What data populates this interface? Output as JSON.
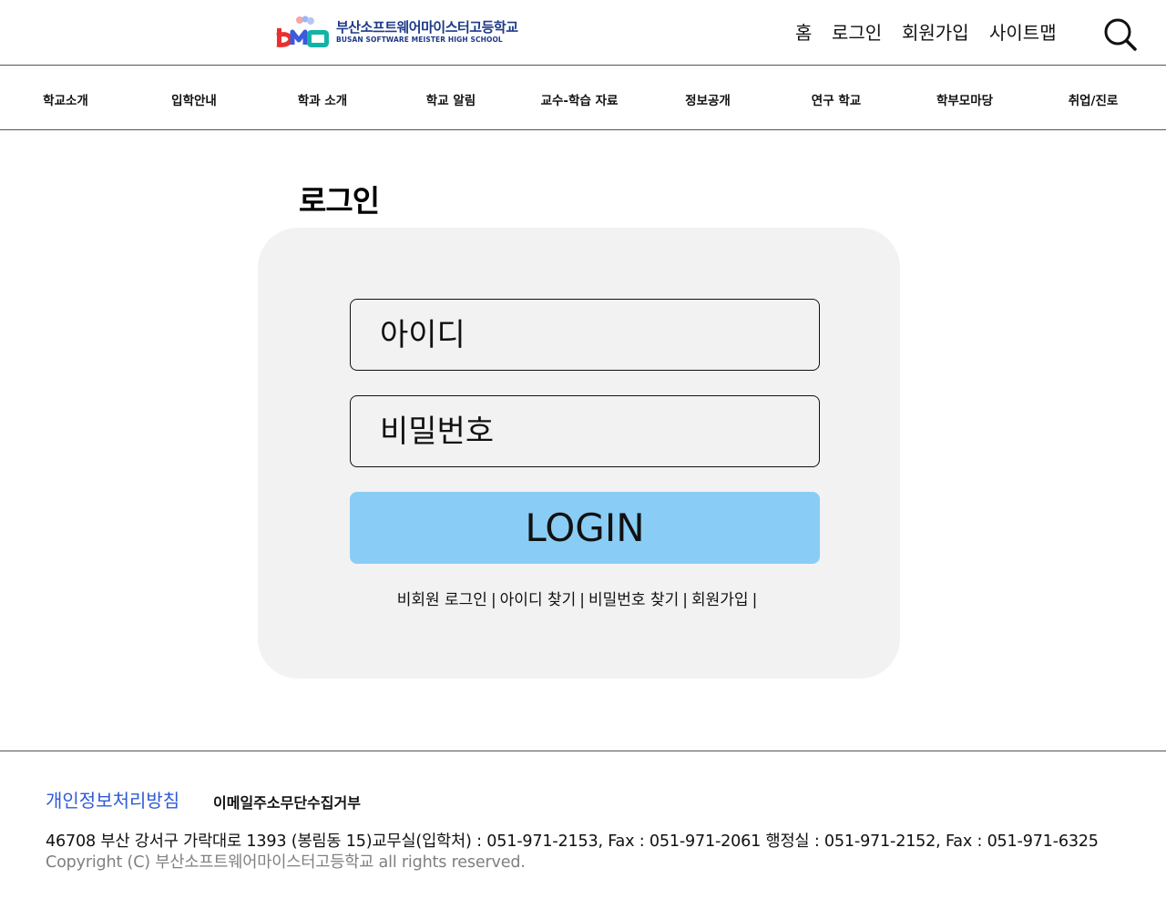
{
  "header": {
    "logo": {
      "name_ko": "부산소프트웨어마이스터고등학교",
      "name_en": "BUSAN SOFTWARE MEISTER HIGH SCHOOL",
      "mark_text": "bsm"
    },
    "top_links": [
      "홈",
      "로그인",
      "회원가입",
      "사이트맵"
    ],
    "search_icon": "search-icon"
  },
  "main_nav": [
    "학교소개",
    "입학안내",
    "학과 소개",
    "학교 알림",
    "교수-학습 자료",
    "정보공개",
    "연구 학교",
    "학부모마당",
    "취업/진로"
  ],
  "login": {
    "title": "로그인",
    "id_placeholder": "아이디",
    "password_placeholder": "비밀번호",
    "button_label": "LOGIN",
    "links": [
      "비회원 로그인",
      "아이디 찾기",
      "비밀번호 찾기",
      "회원가입"
    ],
    "separator": "|"
  },
  "footer": {
    "privacy_policy": "개인정보처리방침",
    "email_refusal": "이메일주소무단수집거부",
    "address": "46708 부산 강서구 가락대로 1393 (봉림동 15)교무실(입학처) : 051-971-2153, Fax : 051-971-2061 행정실 : 051-971-2152, Fax : 051-971-6325",
    "copyright": "Copyright (C) 부산소프트웨어마이스터고등학교 all rights reserved."
  },
  "colors": {
    "login_button": "#89cdf6",
    "card_background": "#f2f2f2",
    "privacy_link": "#2f5ad8",
    "logo_text": "#1d3a8a",
    "copyright_text": "#808080"
  }
}
